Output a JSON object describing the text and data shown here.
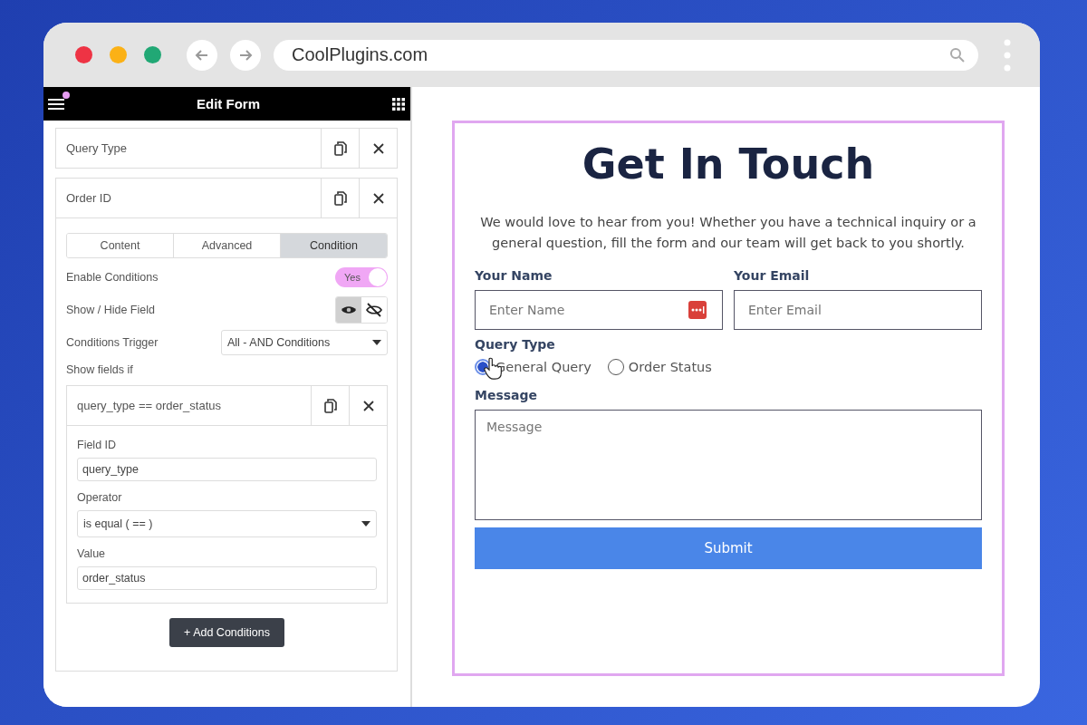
{
  "browser": {
    "url": "CoolPlugins.com"
  },
  "editor": {
    "title": "Edit Form",
    "fields": [
      {
        "label": "Query Type",
        "expanded": false
      },
      {
        "label": "Order ID",
        "expanded": true
      }
    ],
    "tabs": [
      {
        "label": "Content",
        "selected": false
      },
      {
        "label": "Advanced",
        "selected": false
      },
      {
        "label": "Condition",
        "selected": true
      }
    ],
    "enable_conditions": {
      "label": "Enable Conditions",
      "on": true,
      "text": "Yes"
    },
    "show_hide": {
      "label": "Show / Hide Field",
      "options": [
        {
          "kind": "show",
          "selected": true
        },
        {
          "kind": "hide",
          "selected": false
        }
      ]
    },
    "trigger": {
      "label": "Conditions Trigger",
      "value": "All - AND Conditions"
    },
    "show_fields_if": "Show fields if",
    "condition": {
      "title": "query_type == order_status",
      "field_id_label": "Field ID",
      "field_id": "query_type",
      "operator_label": "Operator",
      "operator": "is equal ( == )",
      "value_label": "Value",
      "value": "order_status"
    },
    "add_button": "+ Add Conditions"
  },
  "form": {
    "title": "Get In Touch",
    "intro": "We would love to hear from you! Whether you have a technical inquiry or a general question, fill the form and our team will get back to you shortly.",
    "name_label": "Your Name",
    "name_placeholder": "Enter Name",
    "email_label": "Your Email",
    "email_placeholder": "Enter Email",
    "query_label": "Query Type",
    "options": [
      {
        "label": "General Query",
        "selected": true
      },
      {
        "label": "Order Status",
        "selected": false
      }
    ],
    "message_label": "Message",
    "message_placeholder": "Message",
    "submit": "Submit"
  }
}
